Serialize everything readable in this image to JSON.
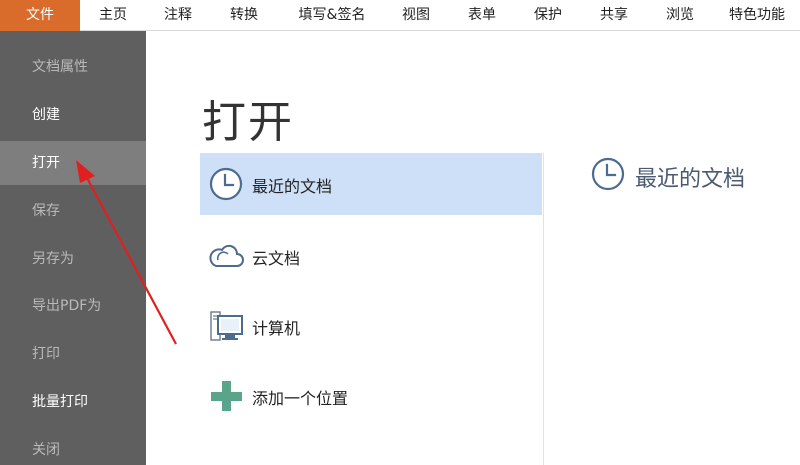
{
  "menubar": {
    "tabs": [
      {
        "label": "文件"
      },
      {
        "label": "主页"
      },
      {
        "label": "注释"
      },
      {
        "label": "转换"
      },
      {
        "label": "填写&签名"
      },
      {
        "label": "视图"
      },
      {
        "label": "表单"
      },
      {
        "label": "保护"
      },
      {
        "label": "共享"
      },
      {
        "label": "浏览"
      },
      {
        "label": "特色功能"
      }
    ],
    "active_color": "#d96c2b"
  },
  "sidebar": {
    "background": "#5f5f5f",
    "items": [
      {
        "label": "文档属性",
        "enabled": false
      },
      {
        "label": "创建",
        "enabled": true
      },
      {
        "label": "打开",
        "enabled": true,
        "selected": true
      },
      {
        "label": "保存",
        "enabled": false
      },
      {
        "label": "另存为",
        "enabled": false
      },
      {
        "label": "导出PDF为",
        "enabled": false
      },
      {
        "label": "打印",
        "enabled": false
      },
      {
        "label": "批量打印",
        "enabled": true
      },
      {
        "label": "关闭",
        "enabled": false
      }
    ]
  },
  "main": {
    "title": "打开",
    "locations": [
      {
        "label": "最近的文档",
        "icon": "clock-icon",
        "selected": true
      },
      {
        "label": "云文档",
        "icon": "cloud-icon"
      },
      {
        "label": "计算机",
        "icon": "computer-icon"
      },
      {
        "label": "添加一个位置",
        "icon": "plus-icon"
      }
    ],
    "recent_panel": {
      "title": "最近的文档",
      "icon": "clock-icon"
    },
    "selection_color": "#cde0f7"
  },
  "annotation": {
    "type": "red-arrow",
    "color": "#e02020",
    "points_to": "打开"
  }
}
